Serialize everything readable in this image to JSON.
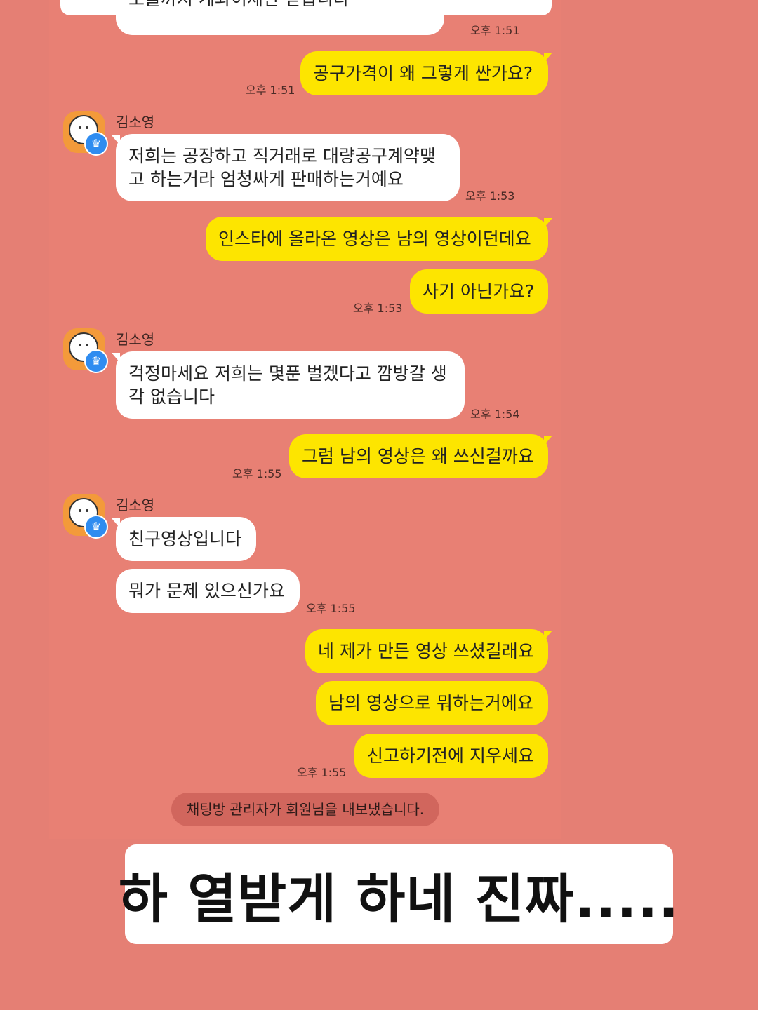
{
  "messages": {
    "m0_text": "오늘까지 계좌이체만 받습니다",
    "m0_time": "오후 1:51",
    "m1_text": "공구가격이 왜 그렇게 싼가요?",
    "m1_time": "오후 1:51",
    "sender_name": "김소영",
    "m2_text": "저희는  공장하고 직거래로 대량공구계약맺고 하는거라 엄청싸게 판매하는거예요",
    "m2_time": "오후 1:53",
    "m3_text": "인스타에 올라온 영상은 남의 영상이던데요",
    "m4_text": "사기 아닌가요?",
    "m4_time": "오후 1:53",
    "m5_text": "걱정마세요 저희는 몇푼 벌겠다고 깜방갈 생각 없습니다",
    "m5_time": "오후 1:54",
    "m6_text": "그럼 남의 영상은 왜 쓰신걸까요",
    "m6_time": "오후 1:55",
    "m7_text": "친구영상입니다",
    "m8_text": "뭐가 문제 있으신가요",
    "m8_time": "오후 1:55",
    "m9_text": "네 제가 만든 영상 쓰셨길래요",
    "m10_text": "남의 영상으로 뭐하는거에요",
    "m11_text": "신고하기전에 지우세요",
    "m11_time": "오후 1:55"
  },
  "system_notice": "채팅방 관리자가 회원님을 내보냈습니다.",
  "caption": "하 열받게 하네 진짜.....",
  "colors": {
    "background": "#e57f74",
    "outgoing_bubble": "#fde500",
    "incoming_bubble": "#ffffff",
    "verified_badge": "#2f8cf0"
  },
  "icons": {
    "avatar": "profile-face-avatar",
    "badge": "crown-icon"
  }
}
